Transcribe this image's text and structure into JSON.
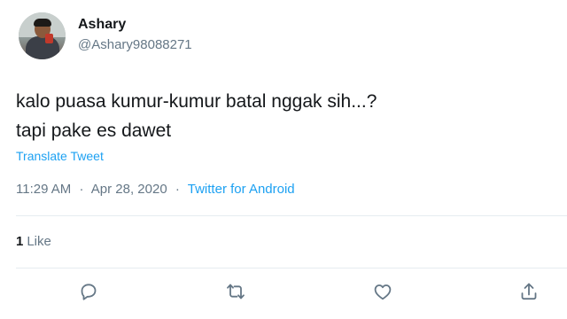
{
  "tweet": {
    "author": {
      "display_name": "Ashary",
      "handle": "@Ashary98088271"
    },
    "text_lines": [
      "kalo puasa kumur-kumur batal nggak sih...?",
      "tapi pake es dawet"
    ],
    "translate_label": "Translate Tweet",
    "time": "11:29 AM",
    "date": "Apr 28, 2020",
    "separator": "·",
    "source": "Twitter for Android",
    "likes": {
      "count": "1",
      "label": "Like"
    }
  },
  "icons": {
    "reply": "reply-icon",
    "retweet": "retweet-icon",
    "like": "heart-icon",
    "share": "share-icon"
  },
  "colors": {
    "accent": "#1da1f2",
    "muted_text": "#657786",
    "primary_text": "#14171a",
    "divider": "#e6ecf0"
  }
}
